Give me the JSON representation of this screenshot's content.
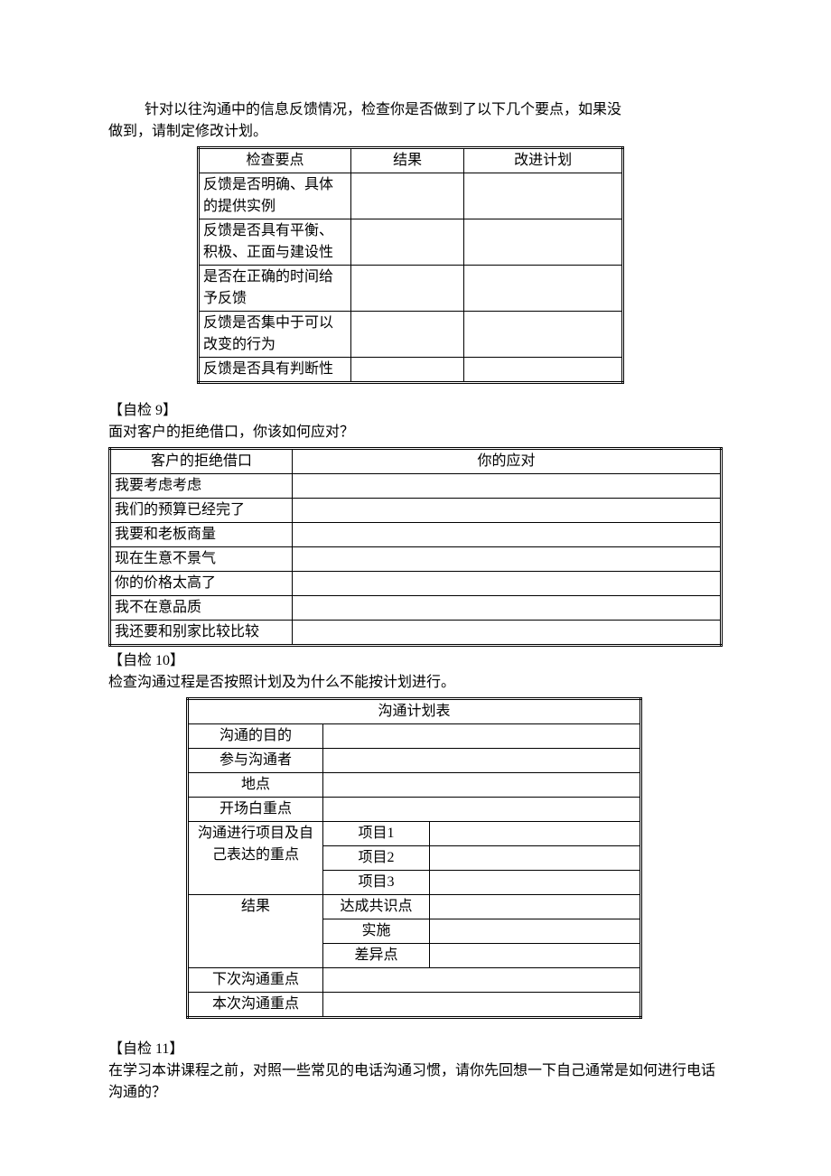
{
  "intro": {
    "line1": "针对以往沟通中的信息反馈情况，检查你是否做到了以下几个要点，如果没",
    "line2": "做到，请制定修改计划。"
  },
  "table1": {
    "headers": [
      "检查要点",
      "结果",
      "改进计划"
    ],
    "rows": [
      [
        "反馈是否明确、具体的提供实例",
        "",
        ""
      ],
      [
        "反馈是否具有平衡、积极、正面与建设性",
        "",
        ""
      ],
      [
        "是否在正确的时间给予反馈",
        "",
        ""
      ],
      [
        "反馈是否集中于可以改变的行为",
        "",
        ""
      ],
      [
        "反馈是否具有判断性",
        "",
        ""
      ]
    ]
  },
  "section9": {
    "heading": "【自检 9】",
    "text": "面对客户的拒绝借口，你该如何应对？"
  },
  "table2": {
    "headers": [
      "客户的拒绝借口",
      "你的应对"
    ],
    "rows": [
      [
        "我要考虑考虑",
        ""
      ],
      [
        "我们的预算已经完了",
        ""
      ],
      [
        "我要和老板商量",
        ""
      ],
      [
        "现在生意不景气",
        ""
      ],
      [
        "你的价格太高了",
        ""
      ],
      [
        "我不在意品质",
        ""
      ],
      [
        "我还要和别家比较比较",
        ""
      ]
    ]
  },
  "section10": {
    "heading": "【自检 10】",
    "text": "检查沟通过程是否按照计划及为什么不能按计划进行。"
  },
  "table3": {
    "title": "沟通计划表",
    "rows": {
      "r1": {
        "label": "沟通的目的"
      },
      "r2": {
        "label": "参与沟通者"
      },
      "r3": {
        "label": "地点"
      },
      "r4": {
        "label": "开场白重点"
      },
      "r5": {
        "label": "沟通进行项目及自己表达的重点",
        "items": [
          "项目1",
          "项目2",
          "项目3"
        ]
      },
      "r6": {
        "label": "结果",
        "items": [
          "达成共识点",
          "实施",
          "差异点"
        ]
      },
      "r7": {
        "label": "下次沟通重点"
      },
      "r8": {
        "label": "本次沟通重点"
      }
    }
  },
  "section11": {
    "heading": "【自检 11】",
    "text": "在学习本讲课程之前，对照一些常见的电话沟通习惯，请你先回想一下自己通常是如何进行电话沟通的？"
  }
}
